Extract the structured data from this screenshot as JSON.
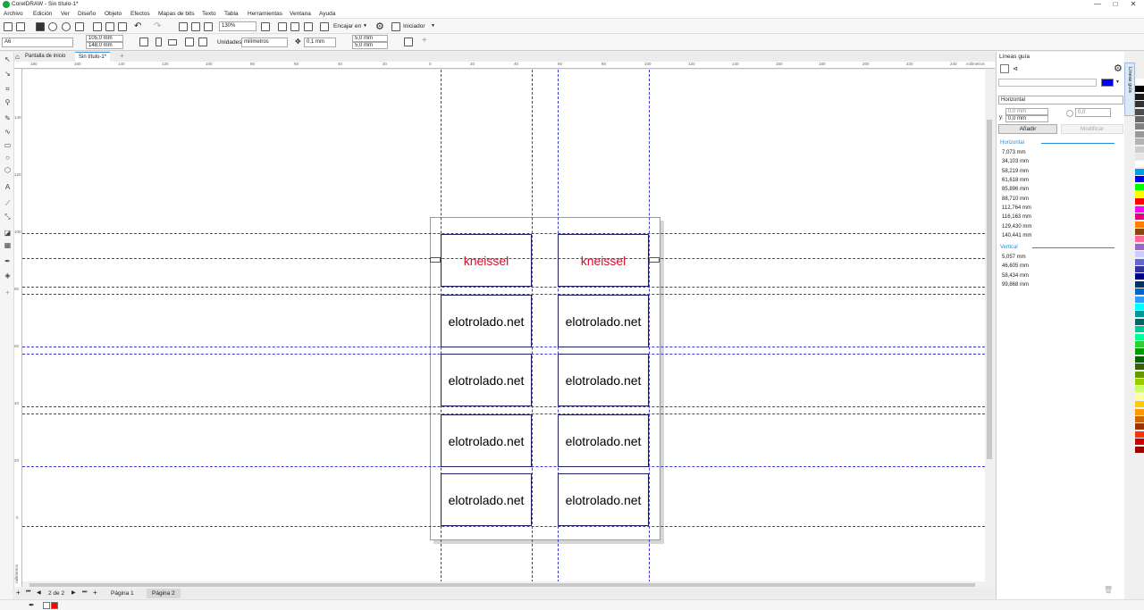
{
  "window": {
    "title": "CorelDRAW - Sin título-1*",
    "controls": [
      "—",
      "□",
      "✕"
    ]
  },
  "menu": [
    "Archivo",
    "Edición",
    "Ver",
    "Diseño",
    "Objeto",
    "Efectos",
    "Mapas de bits",
    "Texto",
    "Tabla",
    "Herramientas",
    "Ventana",
    "Ayuda"
  ],
  "toolbar": {
    "zoom": "130%",
    "snap_label": "Encajar en",
    "launcher_label": "Iniciador"
  },
  "propbar": {
    "page_size": "A6",
    "width": "105,0 mm",
    "height": "148,0 mm",
    "units_label": "Unidades:",
    "units_value": "milímetros",
    "nudge": "0,1 mm",
    "dup_x": "5,0 mm",
    "dup_y": "5,0 mm"
  },
  "doc_tabs": [
    "Pantalla de inicio",
    "Sin título-1*"
  ],
  "ruler": {
    "unit": "milímetros",
    "h_labels": [
      "180",
      "160",
      "140",
      "120",
      "100",
      "80",
      "60",
      "40",
      "20",
      "0",
      "20",
      "40",
      "60",
      "80",
      "100",
      "120",
      "140",
      "160",
      "180",
      "200",
      "220",
      "240"
    ],
    "v_labels": [
      "140",
      "120",
      "100",
      "80",
      "60",
      "40",
      "20",
      "0"
    ],
    "v_unit": "milímetros"
  },
  "cards": [
    {
      "text": "kneissel",
      "highlight": true
    },
    {
      "text": "kneissel",
      "highlight": true
    },
    {
      "text": "elotrolado.net",
      "highlight": false
    },
    {
      "text": "elotrolado.net",
      "highlight": false
    },
    {
      "text": "elotrolado.net",
      "highlight": false
    },
    {
      "text": "elotrolado.net",
      "highlight": false
    },
    {
      "text": "elotrolado.net",
      "highlight": false
    },
    {
      "text": "elotrolado.net",
      "highlight": false
    },
    {
      "text": "elotrolado.net",
      "highlight": false
    },
    {
      "text": "elotrolado.net",
      "highlight": false
    }
  ],
  "page_nav": {
    "counter": "2 de 2",
    "pages": [
      "Página 1",
      "Página 2"
    ],
    "active": "Página 2"
  },
  "docker": {
    "title": "Líneas guía",
    "orientation": "Horizontal",
    "x_value": "0,0 mm",
    "y_label": "y:",
    "y_value": "0,0 mm",
    "angle": "0,0",
    "add_label": "Añadir",
    "modify_label": "Modificar",
    "tab_label": "Líneas guía",
    "guide_color": "#0000ff",
    "horizontal_header": "Horizontal",
    "horizontal_guides": [
      "7,073 mm",
      "34,103 mm",
      "58,219 mm",
      "61,618 mm",
      "85,896 mm",
      "88,710 mm",
      "112,764 mm",
      "116,163 mm",
      "129,430 mm",
      "140,441 mm"
    ],
    "vertical_header": "Vertical",
    "vertical_guides": [
      "5,057 mm",
      "46,605 mm",
      "58,434 mm",
      "99,868 mm"
    ]
  },
  "palette": [
    "#ffffff",
    "#000000",
    "#1a1a1a",
    "#333333",
    "#4d4d4d",
    "#666666",
    "#808080",
    "#999999",
    "#b3b3b3",
    "#cccccc",
    "#e6e6e6",
    "#ffffff",
    "#00a0e9",
    "#0000ff",
    "#00ff00",
    "#ffff00",
    "#ff0000",
    "#ff00ff",
    "#e4007f",
    "#ff8000",
    "#8b4513",
    "#ff6699",
    "#9966cc",
    "#ccccff",
    "#6666cc",
    "#333399",
    "#000080",
    "#003366",
    "#0066cc",
    "#3399ff",
    "#00ffff",
    "#009999",
    "#006666",
    "#00cc99",
    "#00ff99",
    "#33cc33",
    "#009900",
    "#006600",
    "#336600",
    "#669900",
    "#99cc00",
    "#ccff66",
    "#ffff99",
    "#ffcc00",
    "#ff9900",
    "#cc6600",
    "#993300",
    "#ff3300",
    "#cc0000",
    "#990000"
  ],
  "status": {
    "fill_color": "#ff0000"
  }
}
